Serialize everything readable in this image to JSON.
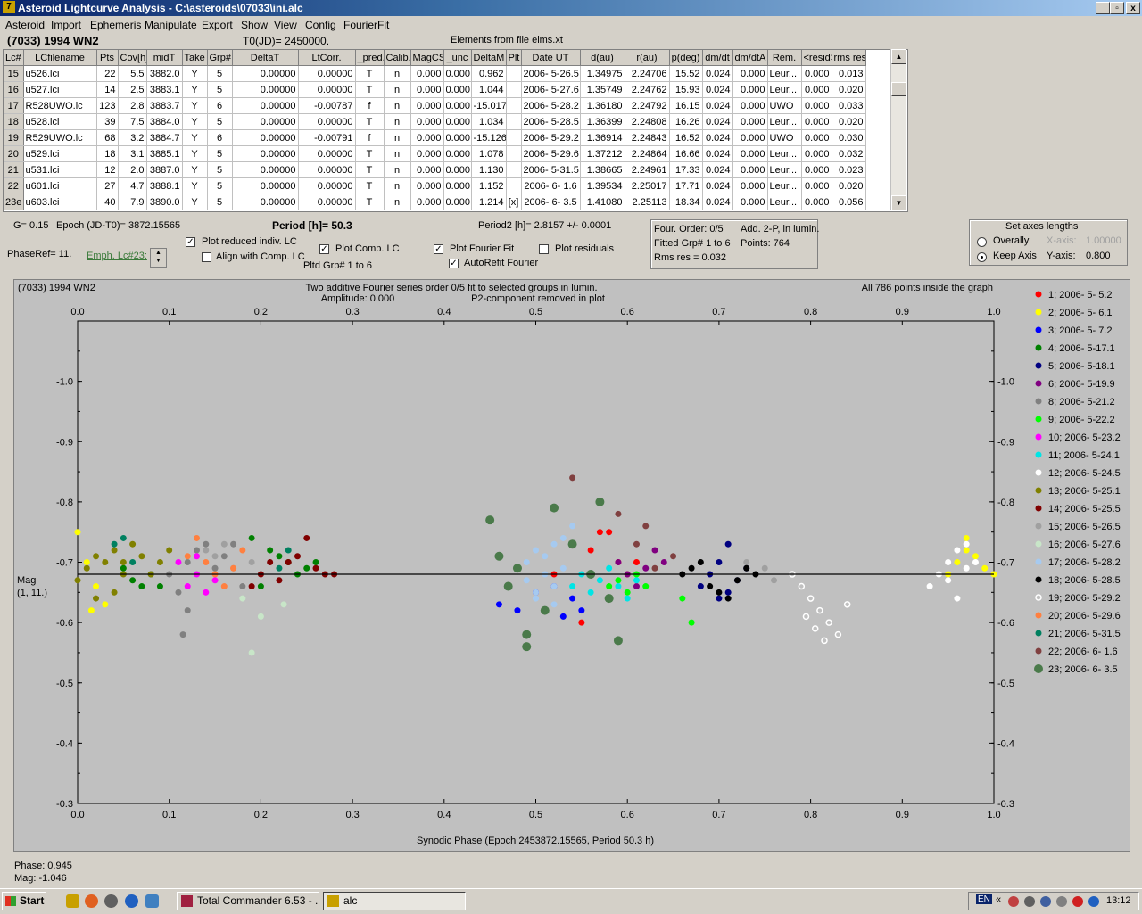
{
  "window": {
    "title": "Asteroid Lightcurve Analysis - C:\\asteroids\\07033\\ini.alc",
    "min_label": "_",
    "max_label": "▫",
    "close_label": "x"
  },
  "menu": [
    "Asteroid",
    "Import",
    "Ephemeris",
    "Manipulate",
    "Export",
    "Show",
    "View",
    "Config",
    "FourierFit"
  ],
  "header": {
    "object": "(7033) 1994 WN2",
    "t0": "T0(JD)= 2450000.",
    "elements": "Elements from file elms.xt"
  },
  "table": {
    "columns": [
      "Lc#",
      "LCfilename",
      "Pts",
      "Cov[h]",
      "midT",
      "Take",
      "Grp#",
      "DeltaT",
      "LtCorr.",
      "_pred.",
      "Calib.",
      "MagCS",
      "_unc",
      "DeltaM",
      "Plt",
      "Date UT",
      "d(au)",
      "r(au)",
      "p(deg)",
      "dm/dt",
      "dm/dtA",
      "Rem.",
      "<resid>",
      "rms res"
    ],
    "rows": [
      [
        "15",
        "u526.lci",
        "22",
        "5.5",
        "3882.0",
        "Y",
        "5",
        "0.00000",
        "0.00000",
        "T",
        "n",
        "0.000",
        "0.000",
        "0.962",
        "",
        "2006- 5-26.5",
        "1.34975",
        "2.24706",
        "15.52",
        "0.024",
        "0.000",
        "Leur...",
        "0.000",
        "0.013"
      ],
      [
        "16",
        "u527.lci",
        "14",
        "2.5",
        "3883.1",
        "Y",
        "5",
        "0.00000",
        "0.00000",
        "T",
        "n",
        "0.000",
        "0.000",
        "1.044",
        "",
        "2006- 5-27.6",
        "1.35749",
        "2.24762",
        "15.93",
        "0.024",
        "0.000",
        "Leur...",
        "0.000",
        "0.020"
      ],
      [
        "17",
        "R528UWO.lc",
        "123",
        "2.8",
        "3883.7",
        "Y",
        "6",
        "0.00000",
        "-0.00787",
        "f",
        "n",
        "0.000",
        "0.000",
        "-15.017",
        "",
        "2006- 5-28.2",
        "1.36180",
        "2.24792",
        "16.15",
        "0.024",
        "0.000",
        "UWO",
        "0.000",
        "0.033"
      ],
      [
        "18",
        "u528.lci",
        "39",
        "7.5",
        "3884.0",
        "Y",
        "5",
        "0.00000",
        "0.00000",
        "T",
        "n",
        "0.000",
        "0.000",
        "1.034",
        "",
        "2006- 5-28.5",
        "1.36399",
        "2.24808",
        "16.26",
        "0.024",
        "0.000",
        "Leur...",
        "0.000",
        "0.020"
      ],
      [
        "19",
        "R529UWO.lc",
        "68",
        "3.2",
        "3884.7",
        "Y",
        "6",
        "0.00000",
        "-0.00791",
        "f",
        "n",
        "0.000",
        "0.000",
        "-15.126",
        "",
        "2006- 5-29.2",
        "1.36914",
        "2.24843",
        "16.52",
        "0.024",
        "0.000",
        "UWO",
        "0.000",
        "0.030"
      ],
      [
        "20",
        "u529.lci",
        "18",
        "3.1",
        "3885.1",
        "Y",
        "5",
        "0.00000",
        "0.00000",
        "T",
        "n",
        "0.000",
        "0.000",
        "1.078",
        "",
        "2006- 5-29.6",
        "1.37212",
        "2.24864",
        "16.66",
        "0.024",
        "0.000",
        "Leur...",
        "0.000",
        "0.032"
      ],
      [
        "21",
        "u531.lci",
        "12",
        "2.0",
        "3887.0",
        "Y",
        "5",
        "0.00000",
        "0.00000",
        "T",
        "n",
        "0.000",
        "0.000",
        "1.130",
        "",
        "2006- 5-31.5",
        "1.38665",
        "2.24961",
        "17.33",
        "0.024",
        "0.000",
        "Leur...",
        "0.000",
        "0.023"
      ],
      [
        "22",
        "u601.lci",
        "27",
        "4.7",
        "3888.1",
        "Y",
        "5",
        "0.00000",
        "0.00000",
        "T",
        "n",
        "0.000",
        "0.000",
        "1.152",
        "",
        "2006- 6- 1.6",
        "1.39534",
        "2.25017",
        "17.71",
        "0.024",
        "0.000",
        "Leur...",
        "0.000",
        "0.020"
      ],
      [
        "23e",
        "u603.lci",
        "40",
        "7.9",
        "3890.0",
        "Y",
        "5",
        "0.00000",
        "0.00000",
        "T",
        "n",
        "0.000",
        "0.000",
        "1.214",
        "[x]",
        "2006- 6- 3.5",
        "1.41080",
        "2.25113",
        "18.34",
        "0.024",
        "0.000",
        "Leur...",
        "0.000",
        "0.056"
      ]
    ]
  },
  "controls": {
    "g": "G= 0.15",
    "epoch": "Epoch (JD-T0)= 3872.15565",
    "period": "Period [h]= 50.3",
    "period2": "Period2 [h]= 2.8157 +/- 0.0001",
    "phaseref": "PhaseRef= 11.",
    "emph": "Emph. Lc#23:",
    "plot_reduced": "Plot reduced indiv. LC",
    "align_comp": "Align with Comp. LC",
    "plot_comp": "Plot Comp. LC",
    "pltd_grp": "Pltd Grp#  1   to   6",
    "plot_fourier": "Plot Fourier Fit",
    "autorefit": "AutoRefit Fourier",
    "plot_resid": "Plot residuals",
    "four_order": "Four. Order:  0/5",
    "add2p": "Add. 2-P, in lumin.",
    "fitted": "Fitted Grp# 1 to 6",
    "points": "Points: 764",
    "rms": "Rms res      = 0.032",
    "axes_title": "Set axes lengths",
    "overally": "Overally",
    "keep_axis": "Keep Axis",
    "xaxis": "X-axis:",
    "xaxis_val": "1.00000",
    "yaxis": "Y-axis:",
    "yaxis_val": "0.800"
  },
  "chart_data": {
    "type": "scatter",
    "title": "(7033) 1994 WN2",
    "subtitle1": "Two additive Fourier series order 0/5 fit to selected groups in lumin.",
    "subtitle2": "Amplitude: 0.000",
    "subtitle3": "P2-component removed in plot",
    "status": "All 786 points inside the graph",
    "xlabel": "Synodic Phase (Epoch 2453872.15565, Period 50.3 h)",
    "ylabel": "Mag",
    "ylabel2": "(1, 11.)",
    "xlim": [
      0.0,
      1.0
    ],
    "ylim": [
      -0.3,
      -1.1
    ],
    "x_ticks": [
      "0.0",
      "0.1",
      "0.2",
      "0.3",
      "0.4",
      "0.5",
      "0.6",
      "0.7",
      "0.8",
      "0.9",
      "1.0"
    ],
    "y_ticks": [
      "-0.3",
      "-0.4",
      "-0.5",
      "-0.6",
      "-0.7",
      "-0.8",
      "-0.9",
      "-1.0"
    ],
    "fit_line_y": -0.68,
    "series": [
      {
        "name": "1; 2006- 5- 5.2",
        "color": "#ff0000",
        "shape": "dot",
        "x": [
          0.56,
          0.57,
          0.58,
          0.59,
          0.6,
          0.61,
          0.52,
          0.55
        ],
        "y": [
          -0.72,
          -0.75,
          -0.75,
          -0.7,
          -0.68,
          -0.7,
          -0.68,
          -0.6
        ]
      },
      {
        "name": "2; 2006- 5- 6.1",
        "color": "#ffff00",
        "shape": "dot",
        "x": [
          0.0,
          0.01,
          0.02,
          0.03,
          0.95,
          0.96,
          0.97,
          0.98,
          0.99,
          1.0,
          0.015,
          0.97
        ],
        "y": [
          -0.75,
          -0.7,
          -0.66,
          -0.63,
          -0.68,
          -0.7,
          -0.72,
          -0.71,
          -0.69,
          -0.68,
          -0.62,
          -0.74
        ]
      },
      {
        "name": "3; 2006- 5- 7.2",
        "color": "#0000ff",
        "shape": "dot",
        "x": [
          0.46,
          0.48,
          0.5,
          0.52,
          0.53,
          0.54,
          0.55,
          0.47
        ],
        "y": [
          -0.63,
          -0.62,
          -0.65,
          -0.66,
          -0.61,
          -0.64,
          -0.62,
          -0.66
        ]
      },
      {
        "name": "4; 2006- 5-17.1",
        "color": "#008000",
        "shape": "dot",
        "x": [
          0.05,
          0.06,
          0.07,
          0.08,
          0.09,
          0.22,
          0.23,
          0.24,
          0.25,
          0.26,
          0.21,
          0.19,
          0.2
        ],
        "y": [
          -0.69,
          -0.67,
          -0.66,
          -0.68,
          -0.66,
          -0.71,
          -0.7,
          -0.68,
          -0.69,
          -0.7,
          -0.72,
          -0.74,
          -0.66
        ]
      },
      {
        "name": "5; 2006- 5-18.1",
        "color": "#000080",
        "shape": "dot",
        "x": [
          0.68,
          0.69,
          0.7,
          0.71,
          0.72,
          0.73,
          0.71,
          0.7
        ],
        "y": [
          -0.66,
          -0.68,
          -0.7,
          -0.65,
          -0.67,
          -0.69,
          -0.73,
          -0.64
        ]
      },
      {
        "name": "6; 2006- 5-19.9",
        "color": "#800080",
        "shape": "dot",
        "x": [
          0.59,
          0.6,
          0.61,
          0.62,
          0.63,
          0.64
        ],
        "y": [
          -0.7,
          -0.68,
          -0.66,
          -0.69,
          -0.72,
          -0.7
        ]
      },
      {
        "name": "8; 2006- 5-21.2",
        "color": "#808080",
        "shape": "dot",
        "x": [
          0.1,
          0.11,
          0.12,
          0.13,
          0.14,
          0.15,
          0.16,
          0.17,
          0.18,
          0.12,
          0.115
        ],
        "y": [
          -0.68,
          -0.65,
          -0.7,
          -0.72,
          -0.73,
          -0.69,
          -0.71,
          -0.73,
          -0.66,
          -0.62,
          -0.58
        ]
      },
      {
        "name": "9; 2006- 5-22.2",
        "color": "#00ff00",
        "shape": "dot",
        "x": [
          0.58,
          0.59,
          0.6,
          0.61,
          0.62,
          0.66,
          0.67
        ],
        "y": [
          -0.66,
          -0.67,
          -0.65,
          -0.68,
          -0.66,
          -0.64,
          -0.6
        ]
      },
      {
        "name": "10; 2006- 5-23.2",
        "color": "#ff00ff",
        "shape": "dot",
        "x": [
          0.11,
          0.12,
          0.13,
          0.14,
          0.15,
          0.13
        ],
        "y": [
          -0.7,
          -0.66,
          -0.68,
          -0.65,
          -0.67,
          -0.71
        ]
      },
      {
        "name": "11; 2006- 5-24.1",
        "color": "#00e5e5",
        "shape": "dot",
        "x": [
          0.54,
          0.55,
          0.56,
          0.57,
          0.58,
          0.59,
          0.6,
          0.61
        ],
        "y": [
          -0.66,
          -0.68,
          -0.65,
          -0.67,
          -0.69,
          -0.66,
          -0.64,
          -0.67
        ]
      },
      {
        "name": "12; 2006- 5-24.5",
        "color": "#ffffff",
        "shape": "dot",
        "x": [
          0.93,
          0.94,
          0.95,
          0.96,
          0.97,
          0.98,
          0.96,
          0.95,
          0.97
        ],
        "y": [
          -0.66,
          -0.68,
          -0.7,
          -0.72,
          -0.73,
          -0.7,
          -0.64,
          -0.67,
          -0.69
        ]
      },
      {
        "name": "13; 2006- 5-25.1",
        "color": "#808000",
        "shape": "dot",
        "x": [
          0.0,
          0.01,
          0.02,
          0.03,
          0.04,
          0.05,
          0.06,
          0.07,
          0.08,
          0.09,
          0.1,
          0.04,
          0.02,
          0.05
        ],
        "y": [
          -0.67,
          -0.69,
          -0.71,
          -0.7,
          -0.72,
          -0.7,
          -0.73,
          -0.71,
          -0.68,
          -0.7,
          -0.72,
          -0.65,
          -0.64,
          -0.68
        ]
      },
      {
        "name": "14; 2006- 5-25.5",
        "color": "#800000",
        "shape": "dot",
        "x": [
          0.19,
          0.2,
          0.21,
          0.24,
          0.25,
          0.26,
          0.27,
          0.28,
          0.22,
          0.23
        ],
        "y": [
          -0.66,
          -0.68,
          -0.7,
          -0.71,
          -0.74,
          -0.69,
          -0.68,
          -0.68,
          -0.67,
          -0.7
        ]
      },
      {
        "name": "15; 2006- 5-26.5",
        "color": "#a0a0a0",
        "shape": "dot",
        "x": [
          0.14,
          0.15,
          0.16,
          0.17,
          0.19,
          0.74,
          0.75,
          0.76,
          0.73
        ],
        "y": [
          -0.72,
          -0.71,
          -0.73,
          -0.69,
          -0.7,
          -0.68,
          -0.69,
          -0.67,
          -0.7
        ]
      },
      {
        "name": "16; 2006- 5-27.6",
        "color": "#c8e6c8",
        "shape": "dot",
        "x": [
          0.19,
          0.2,
          0.225,
          0.18
        ],
        "y": [
          -0.55,
          -0.61,
          -0.63,
          -0.64
        ]
      },
      {
        "name": "17; 2006- 5-28.2",
        "color": "#a6caf0",
        "shape": "dot",
        "x": [
          0.48,
          0.49,
          0.5,
          0.51,
          0.52,
          0.53,
          0.54,
          0.5,
          0.52,
          0.49,
          0.51,
          0.53,
          0.52,
          0.5
        ],
        "y": [
          -0.69,
          -0.7,
          -0.72,
          -0.68,
          -0.66,
          -0.74,
          -0.76,
          -0.65,
          -0.63,
          -0.67,
          -0.71,
          -0.69,
          -0.73,
          -0.64
        ]
      },
      {
        "name": "18; 2006- 5-28.5",
        "color": "#000000",
        "shape": "dot",
        "x": [
          0.66,
          0.67,
          0.68,
          0.69,
          0.7,
          0.72,
          0.73,
          0.74,
          0.71
        ],
        "y": [
          -0.68,
          -0.69,
          -0.7,
          -0.66,
          -0.65,
          -0.67,
          -0.69,
          -0.68,
          -0.64
        ]
      },
      {
        "name": "19; 2006- 5-29.2",
        "color": "#ffffff",
        "shape": "open",
        "x": [
          0.78,
          0.79,
          0.8,
          0.81,
          0.82,
          0.83,
          0.84,
          0.815,
          0.805,
          0.795
        ],
        "y": [
          -0.68,
          -0.66,
          -0.64,
          -0.62,
          -0.6,
          -0.58,
          -0.63,
          -0.57,
          -0.59,
          -0.61
        ]
      },
      {
        "name": "20; 2006- 5-29.6",
        "color": "#ff8040",
        "shape": "dot",
        "x": [
          0.12,
          0.13,
          0.14,
          0.15,
          0.16,
          0.17,
          0.18
        ],
        "y": [
          -0.71,
          -0.74,
          -0.7,
          -0.68,
          -0.66,
          -0.69,
          -0.72
        ]
      },
      {
        "name": "21; 2006- 5-31.5",
        "color": "#008060",
        "shape": "dot",
        "x": [
          0.04,
          0.05,
          0.06,
          0.23,
          0.22
        ],
        "y": [
          -0.73,
          -0.74,
          -0.7,
          -0.72,
          -0.69
        ]
      },
      {
        "name": "22; 2006- 6- 1.6",
        "color": "#804040",
        "shape": "dot",
        "x": [
          0.54,
          0.59,
          0.61,
          0.63,
          0.65,
          0.62
        ],
        "y": [
          -0.84,
          -0.78,
          -0.73,
          -0.69,
          -0.71,
          -0.76
        ]
      },
      {
        "name": "23; 2006- 6- 3.5",
        "color": "#4a7a4a",
        "shape": "big",
        "x": [
          0.45,
          0.46,
          0.48,
          0.49,
          0.51,
          0.52,
          0.54,
          0.56,
          0.58,
          0.59,
          0.49,
          0.47,
          0.57
        ],
        "y": [
          -0.77,
          -0.71,
          -0.69,
          -0.58,
          -0.62,
          -0.79,
          -0.73,
          -0.68,
          -0.64,
          -0.57,
          -0.56,
          -0.66,
          -0.8
        ]
      }
    ]
  },
  "status": {
    "phase": "Phase:  0.945",
    "mag": "Mag:    -1.046"
  },
  "taskbar": {
    "start": "Start",
    "task1": "Total Commander 6.53 - ...",
    "task2": "alc",
    "lang": "EN",
    "clock": "13:12"
  }
}
